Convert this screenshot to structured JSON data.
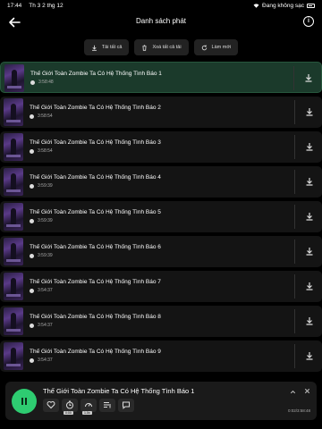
{
  "status": {
    "time": "17:44",
    "date": "Th 3 2 thg 12",
    "charging": "Đang không sạc"
  },
  "header": {
    "title": "Danh sách phát"
  },
  "actions": [
    {
      "label": "Tải tất cả",
      "icon": "download-icon"
    },
    {
      "label": "Xoá tất cả tải",
      "icon": "trash-icon"
    },
    {
      "label": "Làm mới",
      "icon": "refresh-icon"
    }
  ],
  "tracks": [
    {
      "title": "Thế Giới Toàn Zombie Ta Có Hệ Thống Tình Báo 1",
      "duration": "3:58:48"
    },
    {
      "title": "Thế Giới Toàn Zombie Ta Có Hệ Thống Tình Báo 2",
      "duration": "3:58:54"
    },
    {
      "title": "Thế Giới Toàn Zombie Ta Có Hệ Thống Tình Báo 3",
      "duration": "3:58:54"
    },
    {
      "title": "Thế Giới Toàn Zombie Ta Có Hệ Thống Tình Báo 4",
      "duration": "3:59:39"
    },
    {
      "title": "Thế Giới Toàn Zombie Ta Có Hệ Thống Tình Báo 5",
      "duration": "3:59:39"
    },
    {
      "title": "Thế Giới Toàn Zombie Ta Có Hệ Thống Tình Báo 6",
      "duration": "3:59:39"
    },
    {
      "title": "Thế Giới Toàn Zombie Ta Có Hệ Thống Tình Báo 7",
      "duration": "3:54:37"
    },
    {
      "title": "Thế Giới Toàn Zombie Ta Có Hệ Thống Tình Báo 8",
      "duration": "3:54:37"
    },
    {
      "title": "Thế Giới Toàn Zombie Ta Có Hệ Thống Tình Báo 9",
      "duration": "3:54:37"
    }
  ],
  "player": {
    "title": "Thế Giới Toàn Zombie Ta Có Hệ Thống Tình Báo 1",
    "progress": "0:02/3:58:48",
    "timer_tag": "0:00",
    "speed_tag": "1.0x"
  },
  "colors": {
    "accent": "#2ecc71",
    "active_row": "#1b3a2b"
  }
}
